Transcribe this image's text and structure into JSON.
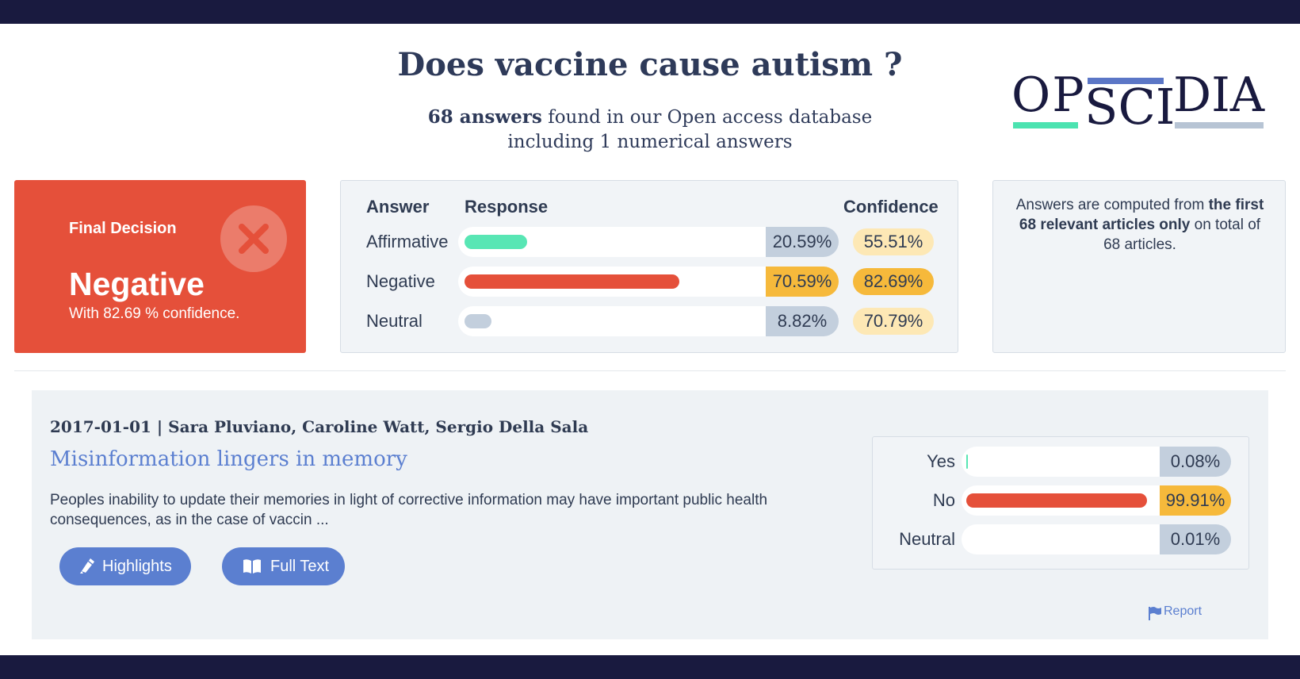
{
  "header": {
    "question": "Does vaccine cause autism ?",
    "answers_count": "68 answers",
    "answers_found_text": "found in our Open access database",
    "numerical_text": "including 1 numerical answers"
  },
  "logo": {
    "op": "OP",
    "sci": "SCI",
    "dia": "DIA"
  },
  "decision": {
    "label": "Final Decision",
    "value": "Negative",
    "confidence_text": "With 82.69 % confidence."
  },
  "answers_table": {
    "col_answer": "Answer",
    "col_response": "Response",
    "col_confidence": "Confidence",
    "rows": [
      {
        "label": "Affirmative",
        "response": "20.59%",
        "response_value": 0.2059,
        "confidence": "55.51%",
        "bar_color": "#58e6b4",
        "pct_bg": "#c3cfdd",
        "conf_bg": "#fde8b5"
      },
      {
        "label": "Negative",
        "response": "70.59%",
        "response_value": 0.7059,
        "confidence": "82.69%",
        "bar_color": "#e5503a",
        "pct_bg": "#f6b93b",
        "conf_bg": "#f6b93b"
      },
      {
        "label": "Neutral",
        "response": "8.82%",
        "response_value": 0.0882,
        "confidence": "70.79%",
        "bar_color": "#c3cfdd",
        "pct_bg": "#c3cfdd",
        "conf_bg": "#fde8b5"
      }
    ]
  },
  "info": {
    "part1": "Answers are computed from ",
    "bold": "the first 68 relevant articles only",
    "part2": " on total of 68 articles."
  },
  "article": {
    "date": "2017-01-01",
    "separator": " | ",
    "authors": "Sara Pluviano, Caroline Watt, Sergio Della Sala",
    "title": "Misinformation lingers in memory",
    "abstract": "Peoples inability to update their memories in light of corrective information may have important public health consequences, as in the case of vaccin ...",
    "highlights_label": "Highlights",
    "fulltext_label": "Full Text",
    "report_label": "Report",
    "scores": [
      {
        "label": "Yes",
        "value": "0.08%",
        "fraction": 0.0008,
        "bar_color": "#58e6b4",
        "pct_bg": "#c3cfdd"
      },
      {
        "label": "No",
        "value": "99.91%",
        "fraction": 0.9991,
        "bar_color": "#e5503a",
        "pct_bg": "#f6b93b"
      },
      {
        "label": "Neutral",
        "value": "0.01%",
        "fraction": 0.0001,
        "bar_color": "#c3cfdd",
        "pct_bg": "#c3cfdd"
      }
    ]
  },
  "colors": {
    "navy": "#191a3f",
    "decision_red": "#e5503a",
    "accent_blue": "#5b7fd0"
  }
}
